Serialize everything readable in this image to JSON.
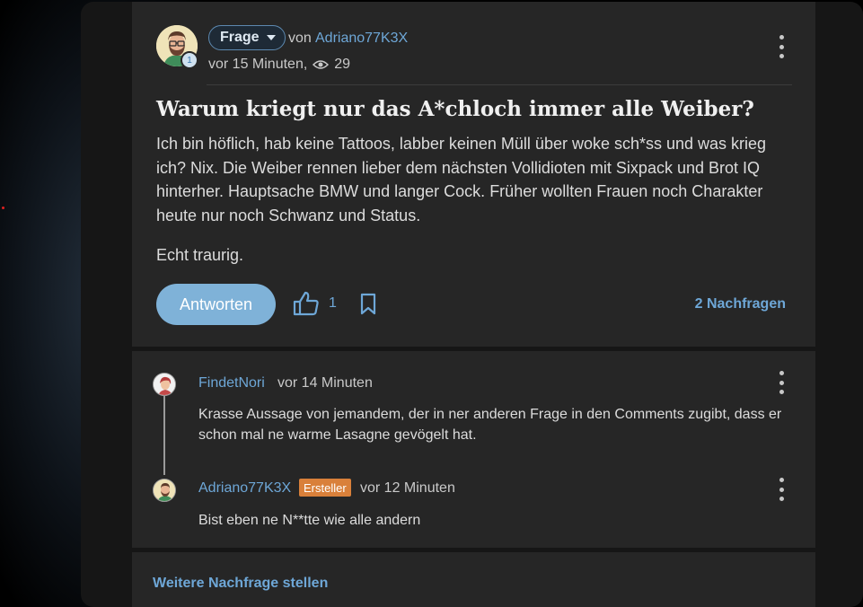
{
  "question": {
    "tag": "Frage",
    "by_prefix": "von",
    "author": "Adriano77K3X",
    "badge_number": "1",
    "time": "vor 15 Minuten,",
    "views": "29",
    "title": "Warum kriegt nur das A*chloch immer alle Weiber?",
    "body_p1": "Ich bin höflich, hab keine Tattoos, labber keinen Müll über woke sch*ss und was krieg ich? Nix. Die Weiber rennen lieber dem nächsten Vollidioten mit Sixpack und Brot IQ hinterher. Hauptsache BMW und langer Cock. Früher wollten Frauen noch Charakter heute nur noch Schwanz und Status.",
    "body_p2": "Echt traurig.",
    "answer_label": "Antworten",
    "likes": "1",
    "followups_link": "2 Nachfragen"
  },
  "comments": [
    {
      "author": "FindetNori",
      "time": "vor 14 Minuten",
      "text": "Krasse Aussage von jemandem, der in ner anderen Frage in den Comments zugibt, dass er schon mal ne warme Lasagne gevögelt hat."
    },
    {
      "author": "Adriano77K3X",
      "badge": "Ersteller",
      "time": "vor 12 Minuten",
      "text": "Bist eben ne N**tte wie alle andern"
    }
  ],
  "footer": {
    "ask_more": "Weitere Nachfrage stellen"
  },
  "colors": {
    "accent": "#6ea7d7",
    "button": "#7fb2d8",
    "creator_badge": "#d9803a",
    "card": "#262626"
  },
  "icons": [
    "caret-down-icon",
    "eye-icon",
    "more-vertical-icon",
    "thumbs-up-icon",
    "bookmark-icon"
  ]
}
